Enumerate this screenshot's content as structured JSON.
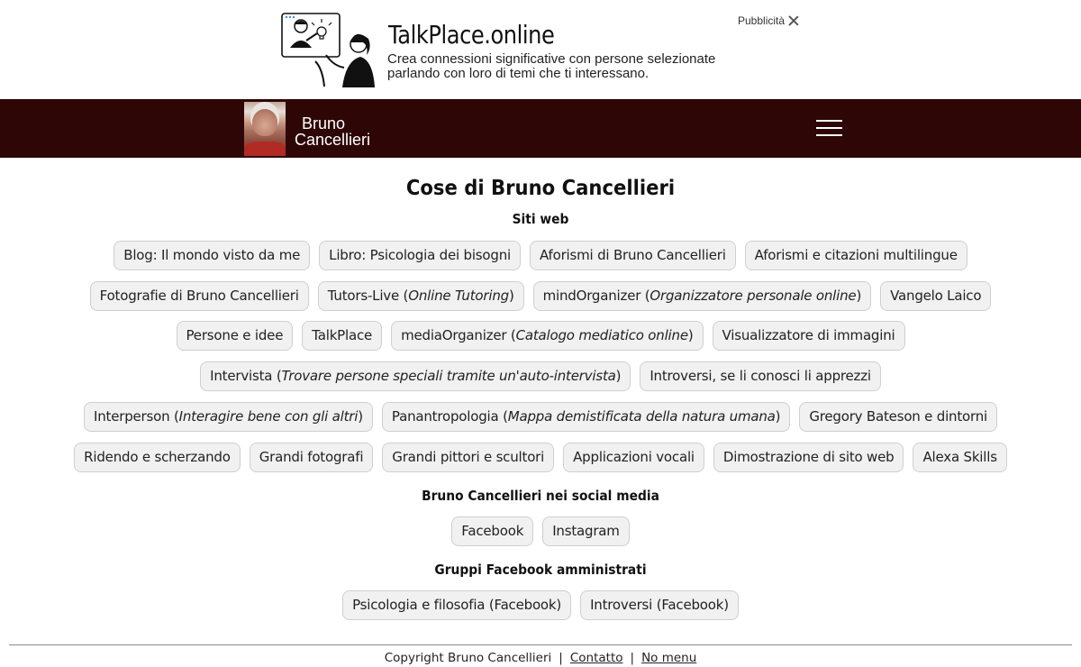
{
  "ad": {
    "title": "TalkPlace.online",
    "desc_line1": "Crea connessioni significative con persone selezionate",
    "desc_line2": "parlando con loro di temi che ti interessano.",
    "label": "Pubblicità"
  },
  "header": {
    "name_line1": "Bruno",
    "name_line2": "Cancellieri",
    "bar_color": "#2e0606"
  },
  "main": {
    "title": "Cose di Bruno Cancellieri",
    "sections": [
      {
        "title": "Siti web",
        "rows": [
          [
            {
              "label": "Blog: Il mondo visto da me"
            },
            {
              "label": "Libro: Psicologia dei bisogni"
            },
            {
              "label": "Aforismi di Bruno Cancellieri"
            },
            {
              "label": "Aforismi e citazioni multilingue"
            }
          ],
          [
            {
              "label": "Fotografie di Bruno Cancellieri"
            },
            {
              "label": "Tutors-Live (",
              "italic": "Online Tutoring",
              "tail": ")"
            },
            {
              "label": "mindOrganizer (",
              "italic": "Organizzatore personale online",
              "tail": ")"
            },
            {
              "label": "Vangelo Laico"
            }
          ],
          [
            {
              "label": "Persone e idee"
            },
            {
              "label": "TalkPlace"
            },
            {
              "label": "mediaOrganizer (",
              "italic": "Catalogo mediatico online",
              "tail": ")"
            },
            {
              "label": "Visualizzatore di immagini"
            }
          ],
          [
            {
              "label": "Intervista (",
              "italic": "Trovare persone speciali tramite un'auto-intervista",
              "tail": ")"
            },
            {
              "label": "Introversi, se li conosci li apprezzi"
            }
          ],
          [
            {
              "label": "Interperson (",
              "italic": "Interagire bene con gli altri",
              "tail": ")"
            },
            {
              "label": "Panantropologia (",
              "italic": "Mappa demistificata della natura umana",
              "tail": ")"
            },
            {
              "label": "Gregory Bateson e dintorni"
            }
          ],
          [
            {
              "label": "Ridendo e scherzando"
            },
            {
              "label": "Grandi fotografi"
            },
            {
              "label": "Grandi pittori e scultori"
            },
            {
              "label": "Applicazioni vocali"
            },
            {
              "label": "Dimostrazione di sito web"
            },
            {
              "label": "Alexa Skills"
            }
          ]
        ]
      },
      {
        "title": "Bruno Cancellieri nei social media",
        "rows": [
          [
            {
              "label": "Facebook"
            },
            {
              "label": "Instagram"
            }
          ]
        ]
      },
      {
        "title": "Gruppi Facebook amministrati",
        "rows": [
          [
            {
              "label": "Psicologia e filosofia (Facebook)"
            },
            {
              "label": "Introversi (Facebook)"
            }
          ]
        ]
      }
    ]
  },
  "footer": {
    "copyright": "Copyright Bruno Cancellieri",
    "sep1": "|",
    "contact": "Contatto",
    "sep2": "|",
    "nomenu": "No menu"
  }
}
